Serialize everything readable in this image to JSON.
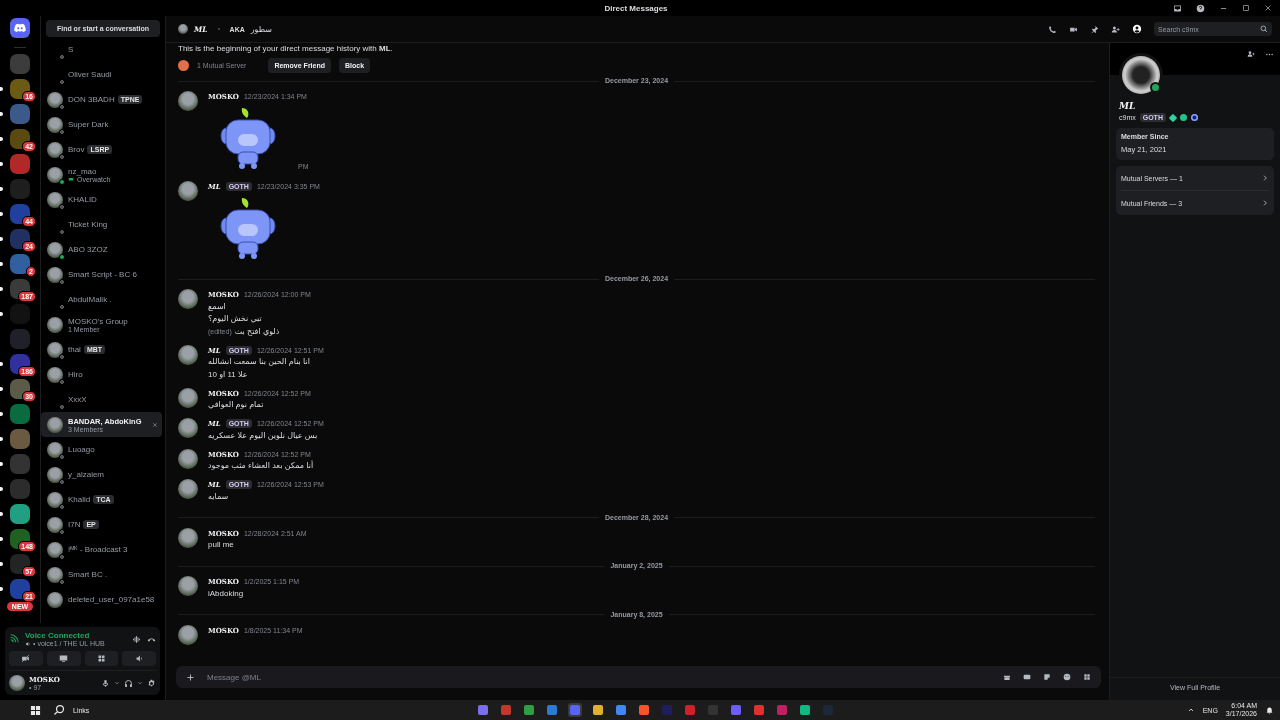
{
  "window": {
    "title": "Direct Messages"
  },
  "search_button": "Find or start a conversation",
  "servers": [
    {
      "color": "#3c3c3c",
      "unread": false
    },
    {
      "color": "#6b5a14",
      "unread": true,
      "badge": "16"
    },
    {
      "color": "#3b5a8a",
      "unread": true
    },
    {
      "color": "#5a4a10",
      "unread": true,
      "badge": "42"
    },
    {
      "color": "#b02828",
      "unread": true
    },
    {
      "color": "#1e1e1e",
      "unread": true
    },
    {
      "color": "#2040a0",
      "unread": true,
      "badge": "44"
    },
    {
      "color": "#203060",
      "unread": true,
      "badge": "24"
    },
    {
      "color": "#3060a0",
      "unread": true,
      "badge": "2"
    },
    {
      "color": "#3a3a3a",
      "unread": true,
      "badge": "187"
    },
    {
      "color": "#121212",
      "unread": true
    },
    {
      "color": "#202028",
      "unread": false
    },
    {
      "color": "#3030a0",
      "unread": true,
      "badge": "186"
    },
    {
      "color": "#5e5a48",
      "unread": true,
      "badge": "30"
    },
    {
      "color": "#0a6a40",
      "unread": true
    },
    {
      "color": "#6a5a40",
      "unread": true
    },
    {
      "color": "#333333",
      "unread": true
    },
    {
      "color": "#2c2c2c",
      "unread": true
    },
    {
      "color": "#20a080",
      "unread": true
    },
    {
      "color": "#206020",
      "unread": true,
      "badge": "148"
    },
    {
      "color": "#242424",
      "unread": true,
      "badge": "57"
    },
    {
      "color": "#2040a0",
      "unread": true,
      "badge": "21"
    }
  ],
  "new_badge": "NEW",
  "dms": [
    {
      "kind": "user",
      "name": "S",
      "avatar": false,
      "online": false,
      "selected": false
    },
    {
      "kind": "user",
      "name": "Oliver Saudi",
      "avatar": false,
      "online": false,
      "selected": false
    },
    {
      "kind": "user",
      "name": "DON 3BADH",
      "tag": "TPNE",
      "avatar": true,
      "online": false,
      "selected": false
    },
    {
      "kind": "user",
      "name": "Super Dark",
      "avatar": true,
      "online": false,
      "selected": false
    },
    {
      "kind": "user",
      "name": "Brov",
      "tag": "LSRP",
      "avatar": true,
      "online": false,
      "selected": false
    },
    {
      "kind": "user",
      "name": "nz_mao",
      "subtitle": "Overwatch",
      "avatar": true,
      "online": true,
      "selected": false
    },
    {
      "kind": "user",
      "name": "KHALID",
      "avatar": true,
      "online": false,
      "selected": false
    },
    {
      "kind": "user",
      "name": "Ticket King",
      "avatar": false,
      "online": false,
      "selected": false
    },
    {
      "kind": "user",
      "name": "ABO 3ZOZ",
      "avatar": true,
      "online": true,
      "selected": false
    },
    {
      "kind": "user",
      "name": "Smart Script - BC 6",
      "avatar": true,
      "online": false,
      "selected": false
    },
    {
      "kind": "user",
      "name": "AbdulMalik .",
      "avatar": false,
      "online": false,
      "selected": false
    },
    {
      "kind": "group",
      "name": "MOSKO's Group",
      "subtitle": "1 Member",
      "avatar": true,
      "selected": false
    },
    {
      "kind": "user",
      "name": "thal",
      "tag": "MBT",
      "avatar": true,
      "online": false,
      "selected": false
    },
    {
      "kind": "user",
      "name": "Hiro",
      "avatar": true,
      "online": false,
      "selected": false
    },
    {
      "kind": "user",
      "name": "XxxX",
      "avatar": false,
      "online": false,
      "selected": false
    },
    {
      "kind": "group",
      "name": "BANDAR, AbdoKinG",
      "subtitle": "3 Members",
      "avatar": true,
      "selected": true
    },
    {
      "kind": "user",
      "name": "Luoago",
      "avatar": true,
      "online": false,
      "selected": false
    },
    {
      "kind": "user",
      "name": "y_alzaiem",
      "avatar": true,
      "online": false,
      "selected": false
    },
    {
      "kind": "user",
      "name": "Khalid",
      "tag": "TCA",
      "avatar": true,
      "online": false,
      "selected": false
    },
    {
      "kind": "user",
      "name": "I7N",
      "tag": "EP",
      "avatar": true,
      "online": false,
      "selected": false
    },
    {
      "kind": "user",
      "name": "!ᴹᴷ - Broadcast 3",
      "avatar": true,
      "online": false,
      "selected": false
    },
    {
      "kind": "user",
      "name": "Smart BC .",
      "avatar": true,
      "online": false,
      "selected": false
    },
    {
      "kind": "group",
      "name": "deleted_user_097a1e58",
      "avatar": true,
      "selected": false
    }
  ],
  "voice": {
    "status": "Voice Connected",
    "channel": "• voice1 / THE UL HUB"
  },
  "user": {
    "name": "MOSKO",
    "status_text": "• 97"
  },
  "chat_header": {
    "name": "ML",
    "aka_label": "AKA",
    "aka": "سطور",
    "search_placeholder": "Search c9mx"
  },
  "intro": {
    "text": "This is the beginning of your direct message history with **ML**.",
    "mutual": "1 Mutual Server",
    "buttons": [
      "Remove Friend",
      "Block"
    ]
  },
  "messages": [
    {
      "kind": "divider",
      "label": "December 23, 2024"
    },
    {
      "kind": "message",
      "author": "MOSKO",
      "time": "12/23/2024 1:34 PM",
      "sticker": true,
      "hover_time": "PM"
    },
    {
      "kind": "message",
      "author": "ML",
      "tag": "GOTH",
      "time": "12/23/2024 3:35 PM",
      "sticker": true
    },
    {
      "kind": "divider",
      "label": "December 26, 2024"
    },
    {
      "kind": "message",
      "author": "MOSKO",
      "time": "12/26/2024 12:00 PM",
      "sticker": false,
      "lines": [
        "اسمع",
        "تبي نخش اليوم؟",
        "ذلوي افتح بث"
      ],
      "edited": "(edited)"
    },
    {
      "kind": "message",
      "author": "ML",
      "tag": "GOTH",
      "time": "12/26/2024 12:51 PM",
      "sticker": false,
      "lines": [
        "انا بنام الحين بنا سمعت انشالله",
        "علا 11 او 10"
      ]
    },
    {
      "kind": "message",
      "author": "MOSKO",
      "time": "12/26/2024 12:52 PM",
      "sticker": false,
      "lines": [
        "تمام نوم العوافي"
      ]
    },
    {
      "kind": "message",
      "author": "ML",
      "tag": "GOTH",
      "time": "12/26/2024 12:52 PM",
      "sticker": false,
      "lines": [
        "بس عيال نلوين اليوم علا عسكريه"
      ]
    },
    {
      "kind": "message",
      "author": "MOSKO",
      "time": "12/26/2024 12:52 PM",
      "sticker": false,
      "lines": [
        "أنا ممكن بعد العشاء مثب موجود"
      ]
    },
    {
      "kind": "message",
      "author": "ML",
      "tag": "GOTH",
      "time": "12/26/2024 12:53 PM",
      "sticker": false,
      "lines": [
        "سمايه"
      ]
    },
    {
      "kind": "divider",
      "label": "December 28, 2024"
    },
    {
      "kind": "message",
      "author": "MOSKO",
      "time": "12/28/2024 2:51 AM",
      "sticker": false,
      "lines": [
        "pull me"
      ]
    },
    {
      "kind": "divider",
      "label": "January 2, 2025"
    },
    {
      "kind": "message",
      "author": "MOSKO",
      "time": "1/2/2025 1:15 PM",
      "sticker": false,
      "lines": [
        "iAbdoking"
      ]
    },
    {
      "kind": "divider",
      "label": "January 8, 2025"
    },
    {
      "kind": "message",
      "author": "MOSKO",
      "time": "1/8/2025 11:34 PM",
      "sticker": false
    }
  ],
  "composer": {
    "placeholder": "Message @ML"
  },
  "profile": {
    "name": "ML",
    "username": "c9mx",
    "tag": "GOTH",
    "online": true,
    "member_since_label": "Member Since",
    "member_since": "May 21, 2021",
    "links": [
      "Mutual Servers — 1",
      "Mutual Friends — 3"
    ],
    "view_full": "View Full Profile"
  },
  "taskbar": {
    "search": "Links",
    "lang": "ENG",
    "time": "6:04 AM",
    "date": "3/17/2026",
    "apps": [
      {
        "color": "#7b6cf0",
        "selected": false
      },
      {
        "color": "#c0392b",
        "selected": false
      },
      {
        "color": "#2ea043",
        "selected": false
      },
      {
        "color": "#2b7bd6",
        "selected": false
      },
      {
        "color": "#5865f2",
        "selected": true
      },
      {
        "color": "#e0b030",
        "selected": false
      },
      {
        "color": "#4285f4",
        "selected": false
      },
      {
        "color": "#fb542b",
        "selected": false
      },
      {
        "color": "#1e1e5a",
        "selected": false
      },
      {
        "color": "#d0202a",
        "selected": false
      },
      {
        "color": "#333333",
        "selected": false
      },
      {
        "color": "#6d5dfc",
        "selected": false
      },
      {
        "color": "#e03030",
        "selected": false
      },
      {
        "color": "#c02060",
        "selected": false
      },
      {
        "color": "#10b981",
        "selected": false
      },
      {
        "color": "#1b2838",
        "selected": false
      }
    ]
  }
}
